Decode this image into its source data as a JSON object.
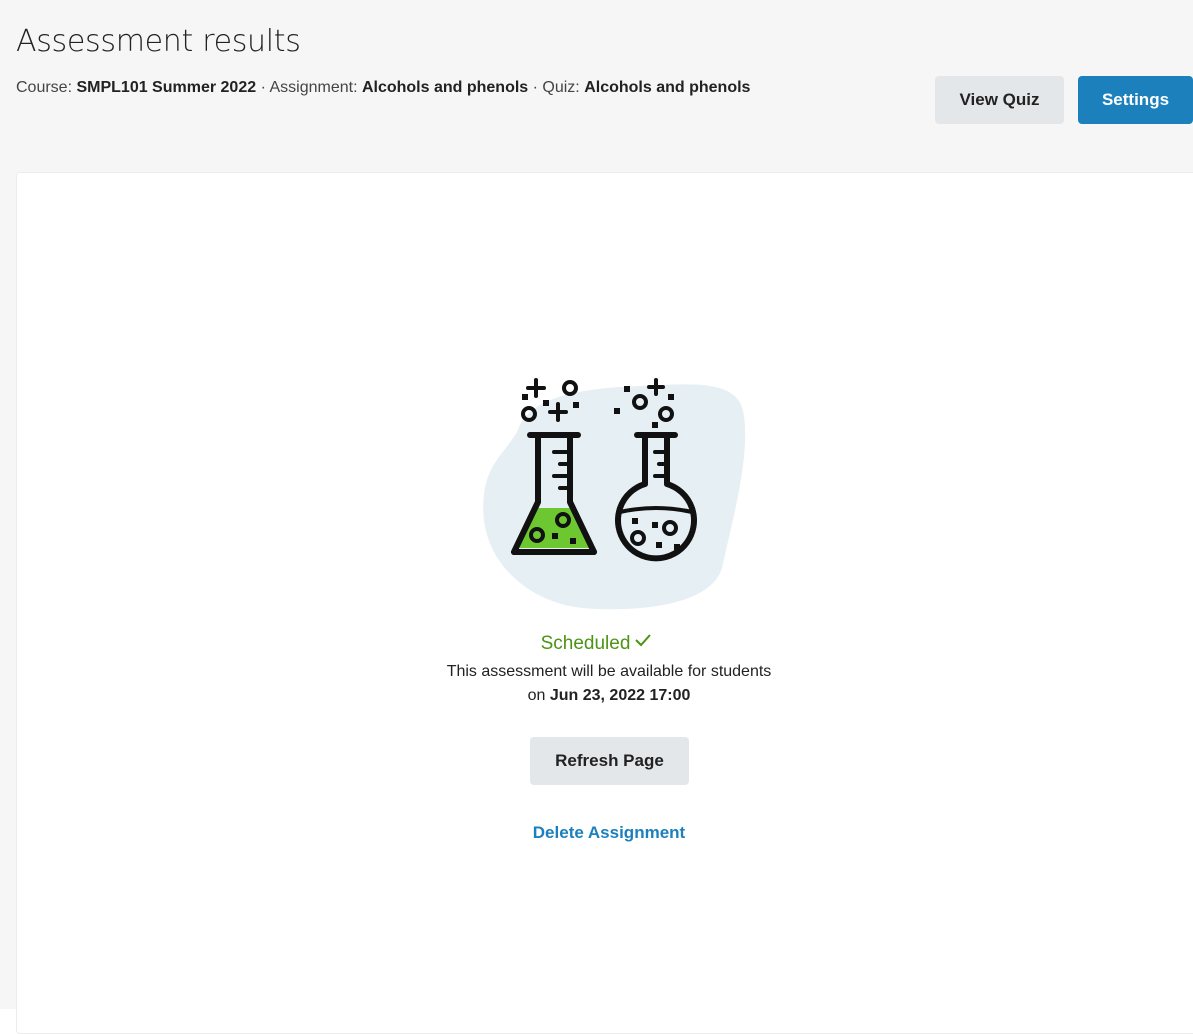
{
  "page": {
    "title": "Assessment results"
  },
  "breadcrumb": {
    "course_label": "Course: ",
    "course_value": "SMPL101 Summer 2022",
    "sep1": " · ",
    "assignment_label": "Assignment: ",
    "assignment_value": "Alcohols and phenols",
    "sep2": " · ",
    "quiz_label": "Quiz: ",
    "quiz_value": "Alcohols and phenols"
  },
  "toolbar": {
    "view_quiz_label": "View Quiz",
    "settings_label": "Settings"
  },
  "status": {
    "label": "Scheduled",
    "message_line1": "This assessment will be available for students",
    "message_prefix": "on ",
    "date": "Jun 23, 2022 17:00",
    "check_icon": "check-icon"
  },
  "actions": {
    "refresh_label": "Refresh Page",
    "delete_label": "Delete Assignment"
  },
  "colors": {
    "primary": "#1c80bd",
    "success": "#4c9413",
    "flask_liquid": "#6cc730",
    "blob": "#e6eff4",
    "secondary_button": "#e4e7ea"
  },
  "illustration": {
    "icon": "science-flasks-icon"
  }
}
